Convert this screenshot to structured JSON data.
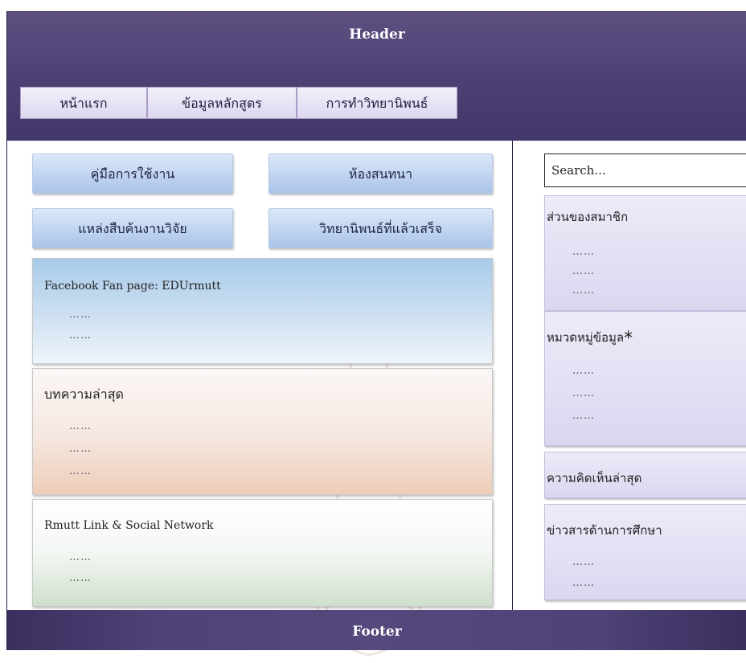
{
  "header": {
    "title": "Header",
    "nav": [
      {
        "label": "หน้าแรก"
      },
      {
        "label": "ข้อมูลหลักสูตร"
      },
      {
        "label": "การทำวิทยานิพนธ์"
      }
    ]
  },
  "left": {
    "buttons": [
      {
        "label": "คู่มือการใช้งาน"
      },
      {
        "label": "ห้องสนทนา"
      },
      {
        "label": "แหล่งสืบค้นงานวิจัย"
      },
      {
        "label": "วิทยานิพนธ์ที่แล้วเสร็จ"
      }
    ],
    "facebook": {
      "title": "Facebook Fan page: EDUrmutt",
      "lines": [
        "……",
        "……"
      ]
    },
    "news": {
      "title": "บทความล่าสุด",
      "lines": [
        "……",
        "……",
        "……"
      ]
    },
    "rmutt": {
      "title": "Rmutt Link & Social Network",
      "lines": [
        "……",
        "……"
      ]
    }
  },
  "right": {
    "search_value": "Search...",
    "members": {
      "title": "ส่วนของสมาชิก",
      "lines": [
        "……",
        "……",
        "……"
      ]
    },
    "categories": {
      "title": "หมวดหมู่ข้อมูล",
      "mark": "*",
      "lines": [
        "……",
        "……",
        "……"
      ]
    },
    "comments": {
      "title": "ความคิดเห็นล่าสุด"
    },
    "edu_news": {
      "title": "ข่าวสารด้านการศึกษา",
      "lines": [
        "……",
        "……"
      ]
    }
  },
  "footer": {
    "title": "Footer"
  },
  "colors": {
    "header_bg": "#4c3f72",
    "footer_bg": "#4e4276",
    "button_blue": "#aac4e8",
    "sidebar_lavender": "#dcd6f0"
  }
}
